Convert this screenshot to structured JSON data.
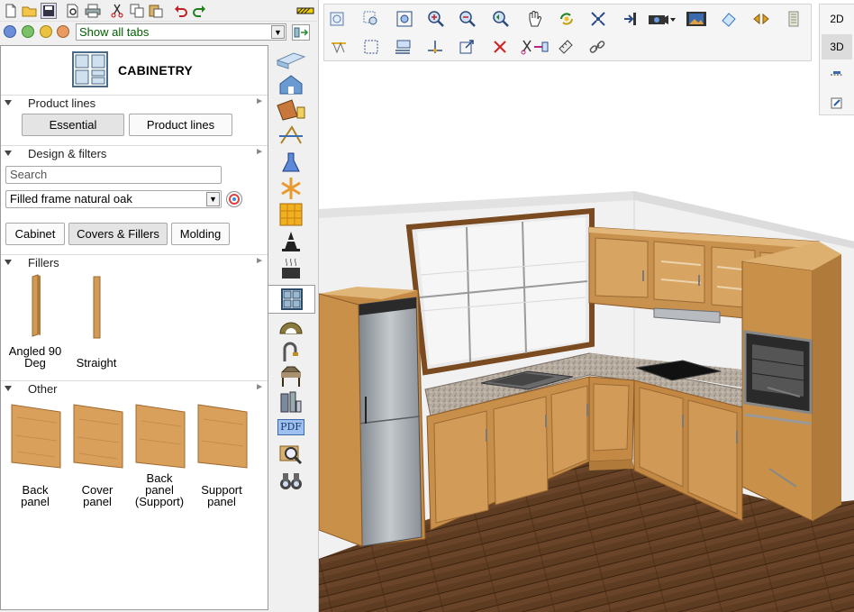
{
  "tabs_filter": {
    "selected": "Show all tabs"
  },
  "panel": {
    "title": "CABINETRY",
    "sections": {
      "product_lines": "Product lines",
      "design_filters": "Design & filters",
      "fillers": "Fillers",
      "other": "Other"
    },
    "product_line_buttons": {
      "essential": "Essential",
      "product_lines": "Product lines"
    },
    "search_placeholder": "Search",
    "finish": "Filled frame natural oak",
    "type_buttons": {
      "cabinet": "Cabinet",
      "covers_fillers": "Covers & Fillers",
      "molding": "Molding"
    },
    "fillers": [
      {
        "line1": "Angled 90",
        "line2": "Deg"
      },
      {
        "line1": "Straight"
      }
    ],
    "other": [
      {
        "line1": "Back",
        "line2": "panel"
      },
      {
        "line1": "Cover",
        "line2": "panel"
      },
      {
        "line1": "Back",
        "line2": "panel",
        "line3": "(Support)"
      },
      {
        "line1": "Support",
        "line2": "panel"
      }
    ]
  },
  "side_tabs": {
    "pdf_label": "PDF"
  },
  "view_mode": {
    "two_d": "2D",
    "three_d": "3D",
    "active": "3D"
  },
  "colors": {
    "wood": "#c9964f",
    "wood_light": "#dcb272",
    "floor": "#5a3a22",
    "wall": "#f2f2f2",
    "steel": "#9fa4a8",
    "accent_green": "#006000"
  }
}
